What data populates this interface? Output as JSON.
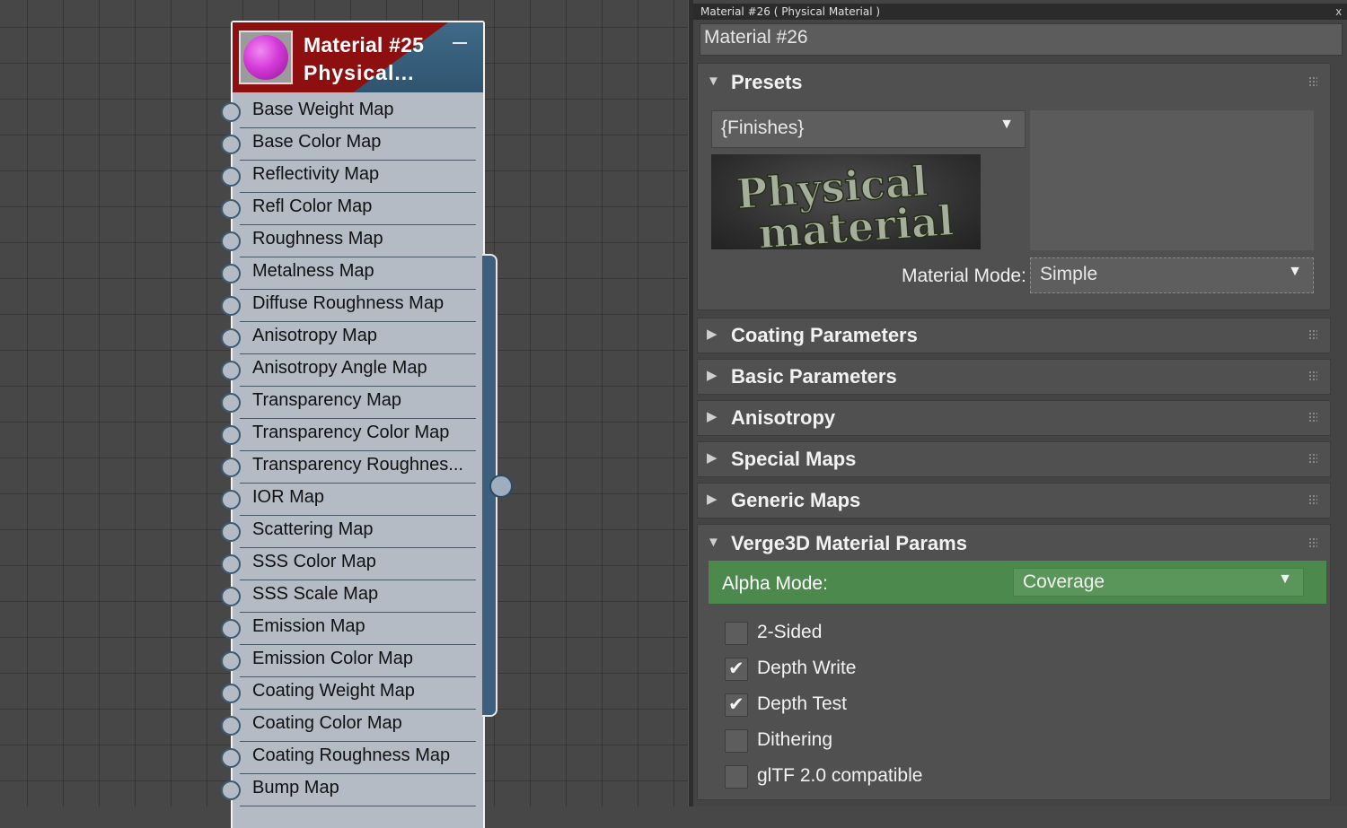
{
  "node": {
    "title_line1": "Material #25",
    "title_line2": "Physical...",
    "slots": [
      "Base Weight Map",
      "Base Color Map",
      "Reflectivity Map",
      "Refl Color Map",
      "Roughness Map",
      "Metalness Map",
      "Diffuse Roughness Map",
      "Anisotropy Map",
      "Anisotropy Angle Map",
      "Transparency Map",
      "Transparency Color Map",
      "Transparency  Roughnes...",
      "IOR Map",
      "Scattering Map",
      "SSS Color Map",
      "SSS Scale Map",
      "Emission Map",
      "Emission Color Map",
      "Coating Weight Map",
      "Coating Color Map",
      "Coating Roughness Map",
      "Bump Map"
    ]
  },
  "panel": {
    "window_title": "Material #26  ( Physical Material )",
    "close_glyph": "x",
    "material_name": "Material #26",
    "presets": {
      "title": "Presets",
      "preset_value": "{Finishes}",
      "image_text_line1": "Physical",
      "image_text_line2": "material",
      "mode_label": "Material Mode:",
      "mode_value": "Simple"
    },
    "collapsed_rollouts": [
      "Coating Parameters",
      "Basic Parameters",
      "Anisotropy",
      "Special Maps",
      "Generic Maps"
    ],
    "verge3d": {
      "title": "Verge3D Material Params",
      "alpha_label": "Alpha Mode:",
      "alpha_value": "Coverage",
      "checkboxes": [
        {
          "label": "2-Sided",
          "checked": false
        },
        {
          "label": "Depth Write",
          "checked": true
        },
        {
          "label": "Depth Test",
          "checked": true
        },
        {
          "label": "Dithering",
          "checked": false
        },
        {
          "label": "glTF 2.0 compatible",
          "checked": false
        }
      ]
    }
  },
  "icons": {
    "expanded": "triangle-down-icon",
    "collapsed": "triangle-right-icon",
    "dropdown": "dropdown-arrow-icon",
    "check": "checkmark-icon",
    "grip": "grip-dots-icon"
  },
  "colors": {
    "node_header_red": "#8e0f10",
    "node_header_blue": "#3f6a87",
    "node_body": "#b4bbc4",
    "alpha_row_green": "#4b8a4c",
    "panel_bg": "#444444",
    "graph_bg": "#474747"
  }
}
